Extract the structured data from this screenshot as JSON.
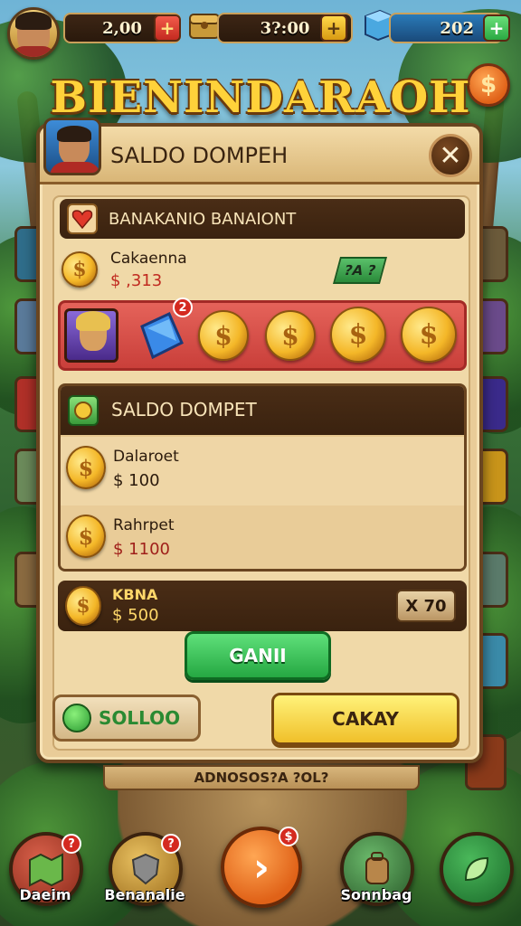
{
  "hud": {
    "resource_1": "2,00",
    "resource_2": "3?:00",
    "resource_3": "202",
    "plus": "+"
  },
  "side_coin_symbol": "$",
  "title": "BIENINDARAOH",
  "panel": {
    "title": "SALDO DOMPEH",
    "close": "✕",
    "section1_title": "BANAKANIO BANAIONT",
    "item": {
      "name": "Cakaenna",
      "value": "$ ,313",
      "tag": "?A ?"
    },
    "reward_badge": "2",
    "wallet": {
      "title": "SALDO DOMPET",
      "rows": [
        {
          "name": "Dalaroet",
          "value": "$ 100"
        },
        {
          "name": "Rahrpet",
          "value": "$ 1100"
        }
      ]
    },
    "total": {
      "name": "KBNA",
      "value": "$ 500",
      "multiplier": "X 70"
    },
    "button_green": "GANII",
    "saldo_pill": "SOLLOO",
    "button_yellow": "CAKAY",
    "under_banner": "ADNOSOS?A ?OL?"
  },
  "nav": {
    "left_label": "Daeim",
    "second_label": "Benanalie",
    "right_label": "Sonnbag",
    "badge_1": "?",
    "badge_2": "?",
    "badge_3": "$",
    "play_symbol": "›"
  },
  "colors": {
    "accent_gold": "#ffd23a",
    "panel_bg": "#e9cc98",
    "dark_brown": "#3a220f",
    "green_button": "#25a842",
    "yellow_button": "#f0c02a",
    "red_strip": "#c93f3a"
  }
}
